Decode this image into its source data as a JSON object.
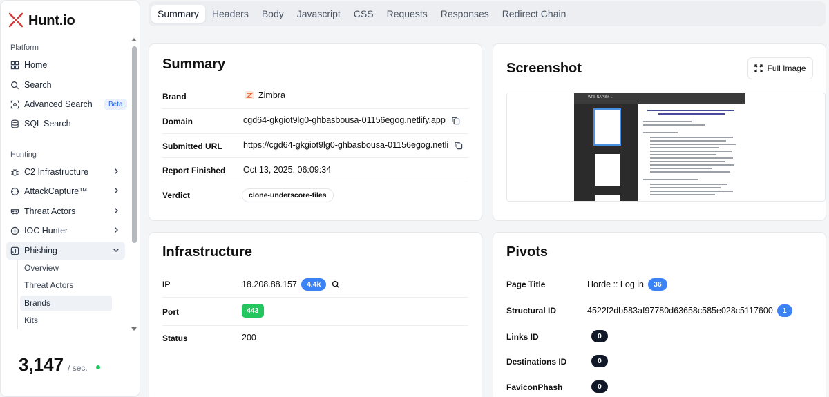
{
  "app": {
    "name": "Hunt.io"
  },
  "sidebar": {
    "platform_label": "Platform",
    "hunting_label": "Hunting",
    "platform_items": [
      {
        "label": "Home",
        "icon": "grid-icon"
      },
      {
        "label": "Search",
        "icon": "search-icon"
      },
      {
        "label": "Advanced Search",
        "icon": "scan-icon",
        "badge": "Beta"
      },
      {
        "label": "SQL Search",
        "icon": "database-icon"
      }
    ],
    "hunting_items": [
      {
        "label": "C2 Infrastructure",
        "icon": "bug-icon"
      },
      {
        "label": "AttackCapture™",
        "icon": "crosshair-icon"
      },
      {
        "label": "Threat Actors",
        "icon": "mask-icon"
      },
      {
        "label": "IOC Hunter",
        "icon": "target-icon"
      },
      {
        "label": "Phishing",
        "icon": "hook-icon"
      }
    ],
    "phishing_sub": [
      {
        "label": "Overview"
      },
      {
        "label": "Threat Actors"
      },
      {
        "label": "Brands"
      },
      {
        "label": "Kits"
      }
    ],
    "counter": {
      "value": "3,147",
      "unit": "/ sec."
    }
  },
  "tabs": [
    {
      "label": "Summary"
    },
    {
      "label": "Headers"
    },
    {
      "label": "Body"
    },
    {
      "label": "Javascript"
    },
    {
      "label": "CSS"
    },
    {
      "label": "Requests"
    },
    {
      "label": "Responses"
    },
    {
      "label": "Redirect Chain"
    }
  ],
  "summary": {
    "title": "Summary",
    "brand_label": "Brand",
    "brand_value": "Zimbra",
    "domain_label": "Domain",
    "domain_value": "cgd64-gkgiot9lg0-ghbasbousa-01156egog.netlify.app",
    "url_label": "Submitted URL",
    "url_value": "https://cgd64-gkgiot9lg0-ghbasbousa-01156egog.netli",
    "finished_label": "Report Finished",
    "finished_value": "Oct 13, 2025, 06:09:34",
    "verdict_label": "Verdict",
    "verdict_value": "clone-underscore-files"
  },
  "screenshot": {
    "title": "Screenshot",
    "full_image_label": "Full Image",
    "doc_title": "WPS NAP 8th ..."
  },
  "infrastructure": {
    "title": "Infrastructure",
    "ip_label": "IP",
    "ip_value": "18.208.88.157",
    "ip_count": "4.4k",
    "port_label": "Port",
    "port_value": "443",
    "status_label": "Status",
    "status_value": "200"
  },
  "pivots": {
    "title": "Pivots",
    "page_title_label": "Page Title",
    "page_title_value": "Horde :: Log in",
    "page_title_count": "36",
    "structural_label": "Structural ID",
    "structural_value": "4522f2db583af97780d63658c585e028c5117600",
    "structural_count": "1",
    "links_label": "Links ID",
    "links_count": "0",
    "dest_label": "Destinations ID",
    "dest_count": "0",
    "favicon_label": "FaviconPhash",
    "favicon_count": "0"
  }
}
